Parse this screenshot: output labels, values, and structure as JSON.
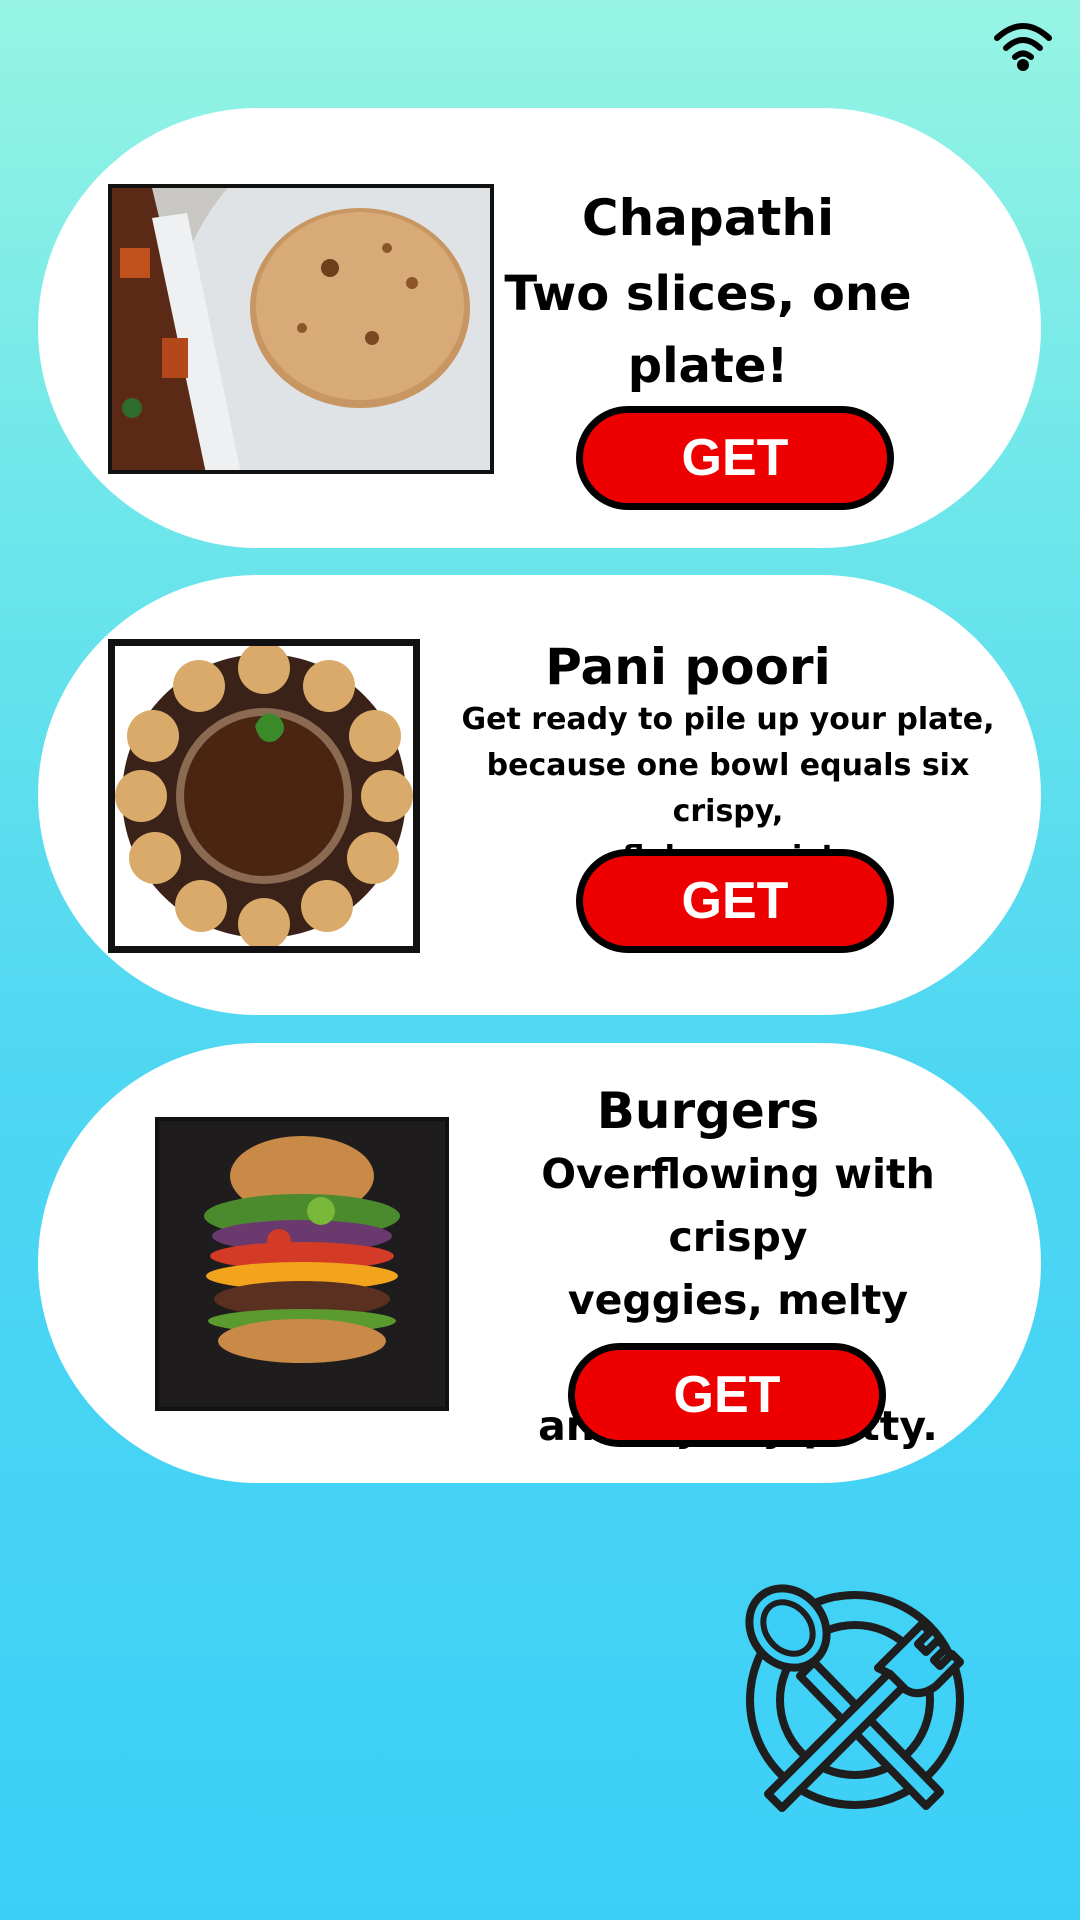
{
  "status_bar": {
    "wifi_icon": "wifi-icon"
  },
  "cards": [
    {
      "title": "Chapathi",
      "description_lines": [
        "Two slices, one",
        "plate!"
      ],
      "button": "GET",
      "image": "chapathi-photo"
    },
    {
      "title": "Pani poori",
      "description_lines": [
        "Get ready to pile up your plate,",
        "because one bowl equals six crispy,",
        "flaky pooris!"
      ],
      "button": "GET",
      "image": "pani-poori-photo"
    },
    {
      "title": "Burgers",
      "description_lines": [
        "Overflowing with crispy",
        "veggies, melty cheese,",
        "and a juicy patty."
      ],
      "button": "GET",
      "image": "burger-photo"
    }
  ],
  "footer": {
    "icon": "spoon-fork-plate-icon"
  },
  "colors": {
    "button": "#ee0000",
    "card": "#ffffff",
    "background_top": "#97f4e3",
    "background_bottom": "#3bcff8"
  }
}
